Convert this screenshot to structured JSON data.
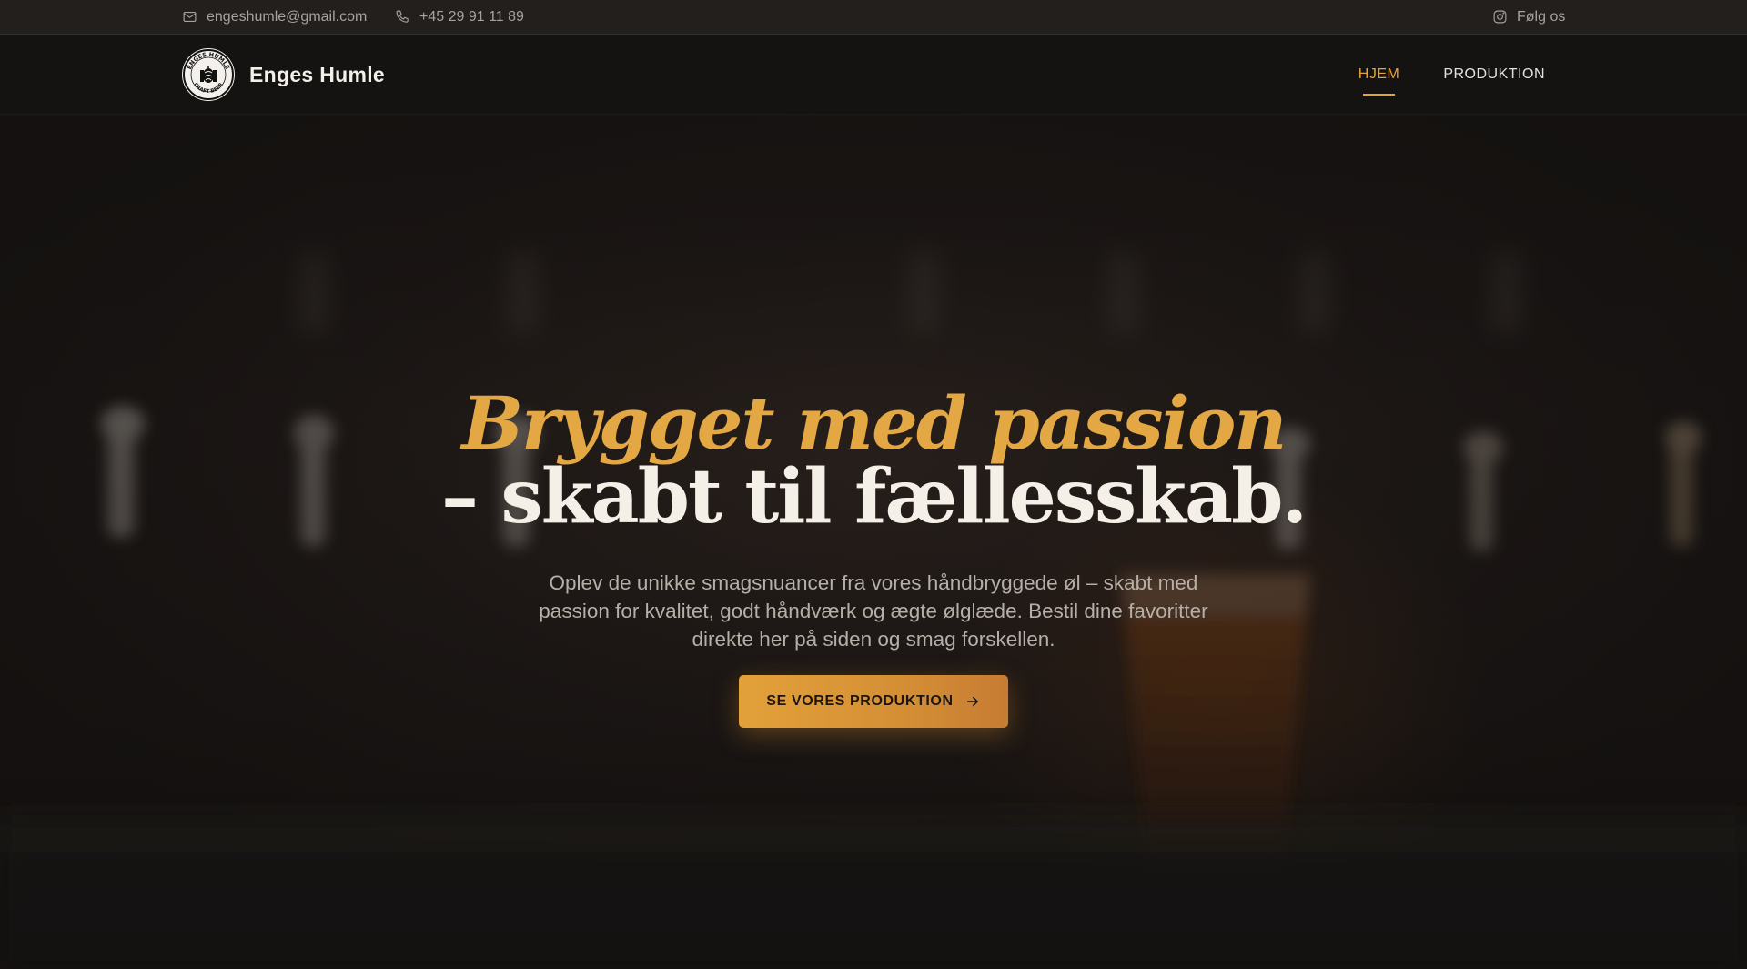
{
  "topbar": {
    "email": "engeshumle@gmail.com",
    "phone": "+45 29 91 11 89",
    "follow": "Følg os",
    "icons": {
      "email": "mail-icon",
      "phone": "phone-icon",
      "follow": "instagram-icon"
    }
  },
  "nav": {
    "brand": "Enges Humle",
    "logo": {
      "top_text": "ENGES HUMLE",
      "bottom_text": "CRAFT BEER"
    },
    "links": [
      {
        "label": "HJEM",
        "active": true
      },
      {
        "label": "PRODUKTION",
        "active": false
      }
    ]
  },
  "hero": {
    "headline_line1": "Brygget med passion",
    "headline_line2": "– skabt til fællesskab.",
    "lead": "Oplev de unikke smagsnuancer fra vores håndbryggede øl – skabt med passion for kvalitet, godt håndværk og ægte ølglæde. Bestil dine favoritter direkte her på siden og smag forskellen.",
    "cta_label": "SE VORES PRODUKTION",
    "cta_icon": "arrow-right-icon"
  },
  "colors": {
    "accent": "#e5a33e",
    "topbar_bg": "#221f1d",
    "nav_bg": "#151312",
    "hero_bg": "#1c1715"
  }
}
